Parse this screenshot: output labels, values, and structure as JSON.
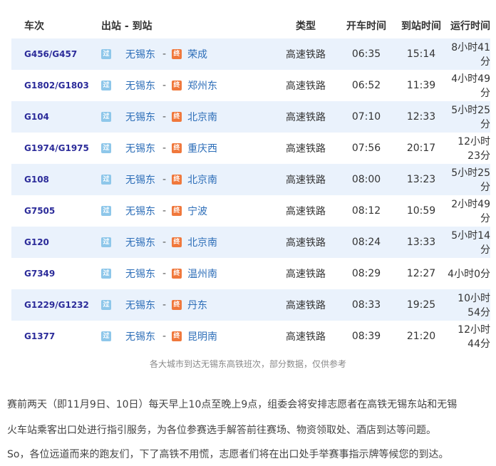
{
  "table": {
    "headers": {
      "train_no": "车次",
      "route": "出站 - 到站",
      "type": "类型",
      "depart": "开车时间",
      "arrive": "到站时间",
      "duration": "运行时间"
    },
    "pass_tag": "过",
    "end_tag": "终",
    "rows": [
      {
        "train_no": "G456/G457",
        "from": "无锡东",
        "sep": "-",
        "to": "荣成",
        "type": "高速铁路",
        "depart": "06:35",
        "arrive": "15:14",
        "duration": "8小时41分"
      },
      {
        "train_no": "G1802/G1803",
        "from": "无锡东",
        "sep": "-",
        "to": "郑州东",
        "type": "高速铁路",
        "depart": "06:52",
        "arrive": "11:39",
        "duration": "4小时49分"
      },
      {
        "train_no": "G104",
        "from": "无锡东",
        "sep": "-",
        "to": "北京南",
        "type": "高速铁路",
        "depart": "07:10",
        "arrive": "12:33",
        "duration": "5小时25分"
      },
      {
        "train_no": "G1974/G1975",
        "from": "无锡东",
        "sep": "-",
        "to": "重庆西",
        "type": "高速铁路",
        "depart": "07:56",
        "arrive": "20:17",
        "duration": "12小时23分"
      },
      {
        "train_no": "G108",
        "from": "无锡东",
        "sep": "-",
        "to": "北京南",
        "type": "高速铁路",
        "depart": "08:00",
        "arrive": "13:23",
        "duration": "5小时25分"
      },
      {
        "train_no": "G7505",
        "from": "无锡东",
        "sep": "-",
        "to": "宁波",
        "type": "高速铁路",
        "depart": "08:12",
        "arrive": "10:59",
        "duration": "2小时49分"
      },
      {
        "train_no": "G120",
        "from": "无锡东",
        "sep": "-",
        "to": "北京南",
        "type": "高速铁路",
        "depart": "08:24",
        "arrive": "13:33",
        "duration": "5小时14分"
      },
      {
        "train_no": "G7349",
        "from": "无锡东",
        "sep": "-",
        "to": "温州南",
        "type": "高速铁路",
        "depart": "08:29",
        "arrive": "12:27",
        "duration": "4小时0分"
      },
      {
        "train_no": "G1229/G1232",
        "from": "无锡东",
        "sep": "-",
        "to": "丹东",
        "type": "高速铁路",
        "depart": "08:33",
        "arrive": "19:25",
        "duration": "10小时54分"
      },
      {
        "train_no": "G1377",
        "from": "无锡东",
        "sep": "-",
        "to": "昆明南",
        "type": "高速铁路",
        "depart": "08:39",
        "arrive": "21:20",
        "duration": "12小时44分"
      }
    ]
  },
  "caption": "各大城市到达无锡东高铁班次，部分数据，仅供参考",
  "paragraph": {
    "line1": "赛前两天（即11月9日、10日）每天早上10点至晚上9点，组委会将安排志愿者在高铁无锡东站和无锡",
    "line2": "火车站乘客出口处进行指引服务，为各位参赛选手解答前往赛场、物资领取处、酒店到达等问题。",
    "line3": "So，各位远道而来的跑友们，下了高铁不用慌，志愿者们将在出口处手举赛事指示牌等候您的到达。"
  },
  "colors": {
    "row_highlight": "#eaf2fc",
    "train_link": "#2c2c9a",
    "station": "#2d6eb8",
    "pass_tag": "#8ec7ea",
    "end_tag": "#f0783c"
  }
}
